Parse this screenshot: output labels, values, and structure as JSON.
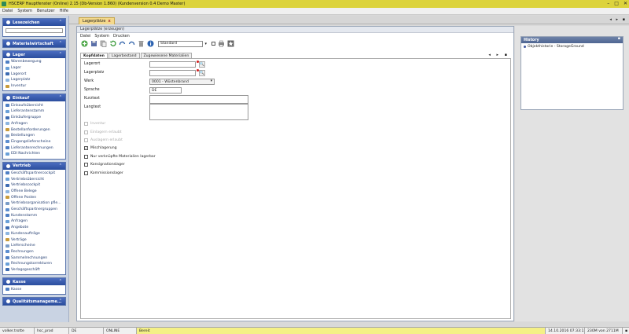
{
  "window": {
    "title": "HSCERP Hauptfenster (Online) 2.15 (Db-Version 1.860) (Kundenversion 0.4 Demo Master)",
    "controls": [
      "–",
      "□",
      "✕"
    ]
  },
  "menubar": [
    "Datei",
    "System",
    "Benutzer",
    "Hilfe"
  ],
  "sidebar": {
    "panels": [
      {
        "title": "Lesezeichen",
        "search": true,
        "items": []
      },
      {
        "title": "Materialwirtschaft",
        "items": []
      },
      {
        "title": "Lager",
        "items": [
          "Warenbewegung",
          "Lager",
          "Lagerort",
          "Lagerplatz",
          "Inventur"
        ]
      },
      {
        "title": "Einkauf",
        "items": [
          "Einkaufsübersicht",
          "Lieferantenstamm",
          "Einkäufergruppe",
          "Anfragen",
          "Bestellanforderungen",
          "Bestellungen",
          "Eingangslieferscheine",
          "Lieferantenrechnungen",
          "EDI Nachrichten"
        ]
      },
      {
        "title": "Vertrieb",
        "items": [
          "Geschäftspartnercockpit",
          "Vertriebsübersicht",
          "Vertriebscockpit",
          "Offene Belege",
          "Offene Posten",
          "Vertriebsorganisation pfle...",
          "Geschäftspartnergruppen",
          "Kundenstamm",
          "Anfragen",
          "Angebote",
          "Kundenaufträge",
          "Verträge",
          "Lieferscheine",
          "Rechnungen",
          "Sammelrechnungen",
          "Rechnungskorrekturen",
          "Verlagsgeschäft"
        ]
      },
      {
        "title": "Kasse",
        "items": [
          "Kasse"
        ]
      },
      {
        "title": "Qualitätsmanageme...",
        "items": []
      }
    ]
  },
  "maintab": {
    "label": "Lagerplätze",
    "close": "x"
  },
  "tab_arrows": "◂ ▸ ▪",
  "workarea": {
    "header": "Lagerplätze (erzeugen)",
    "menu": [
      "Datei",
      "System",
      "Drucken"
    ],
    "toolbar": {
      "combo_value": "Standard",
      "icons": [
        "add-icon",
        "save-icon",
        "copy-icon",
        "refresh-icon",
        "undo-icon",
        "redo-icon",
        "delete-icon",
        "info-icon"
      ]
    },
    "subtabs": [
      "Kopfdaten",
      "Lagerbestand",
      "Zugewiesene Materialien"
    ],
    "subtab_arrows": "◂ ▸ ▪",
    "form": {
      "lagerort_label": "Lagerort",
      "lagerplatz_label": "Lagerplatz",
      "werk_label": "Werk",
      "werk_value": "0001 - Wüstenbrand",
      "sprache_label": "Sprache",
      "sprache_value": "DE",
      "kurztext_label": "Kurztext",
      "langtext_label": "Langtext"
    },
    "checkboxes": [
      {
        "label": "Inventur",
        "checked": false,
        "disabled": true
      },
      {
        "label": "Einlagern erlaubt",
        "checked": false,
        "disabled": true
      },
      {
        "label": "Auslagern erlaubt",
        "checked": false,
        "disabled": true
      },
      {
        "label": "Mischlagerung",
        "checked": true,
        "disabled": false
      },
      {
        "label": "Nur verknüpfte Materialien lagerbar",
        "checked": false,
        "disabled": false
      },
      {
        "label": "Konsignationslager",
        "checked": false,
        "disabled": false
      },
      {
        "label": "Kommissionslager",
        "checked": false,
        "disabled": false
      }
    ]
  },
  "history": {
    "title": "History",
    "items": [
      "Objekthistorie - StorageGround"
    ]
  },
  "statusbar": {
    "user": "volker.trotte",
    "db": "hsc_prod",
    "lang": "DE",
    "mode": "ONLINE",
    "status": "Bereit",
    "datetime": "14.10.2016 07:33:12",
    "memory": "230M von 2711M"
  },
  "colors": {
    "titlebar": "#dcd33c",
    "panel_header": "#2b4e9e",
    "active_tab": "#f4d98c",
    "status_ready": "#f4f086"
  }
}
